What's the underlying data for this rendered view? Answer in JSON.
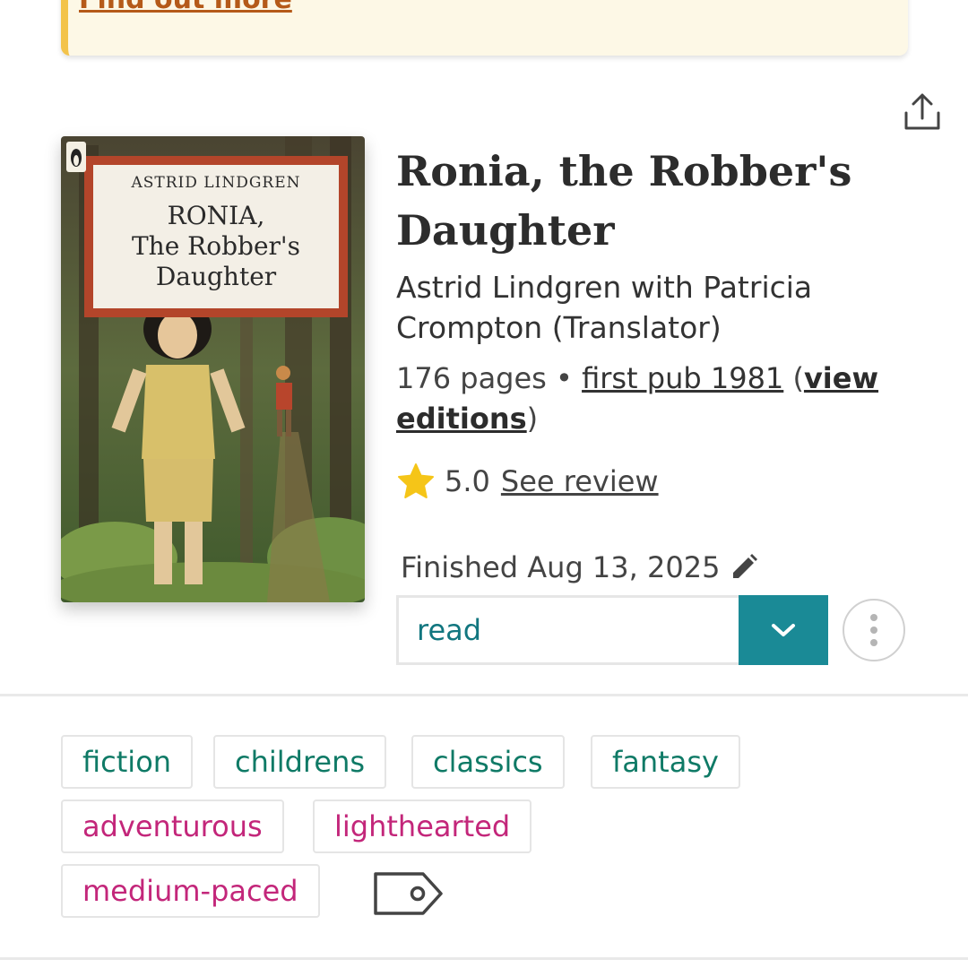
{
  "banner": {
    "link_text": "Find out more"
  },
  "book": {
    "title": "Ronia, the Robber's Daughter",
    "authors": "Astrid Lindgren with Patricia Crompton (Translator)",
    "pages": "176 pages",
    "separator": " • ",
    "first_pub": "first pub 1981",
    "paren_open": " (",
    "view_editions": "view editions",
    "paren_close": ")"
  },
  "cover": {
    "author": "ASTRID LINDGREN",
    "title": "RONIA,\nThe Robber's\nDaughter"
  },
  "rating": {
    "value": "5.0",
    "see_review": "See review",
    "icon": "star-icon"
  },
  "status": {
    "finished_text": "Finished Aug 13, 2025",
    "selected": "read",
    "edit_icon": "pencil-icon"
  },
  "tags": {
    "genres": [
      "fiction",
      "childrens",
      "classics",
      "fantasy"
    ],
    "moods": [
      "adventurous",
      "lighthearted"
    ],
    "pace": [
      "medium-paced"
    ]
  },
  "colors": {
    "accent": "#1a8a96",
    "genre_tag": "#0f7a66",
    "mood_tag": "#c3267a",
    "banner_bg": "#fdf8e6",
    "banner_border": "#f3c34a",
    "star": "#f5c518"
  }
}
